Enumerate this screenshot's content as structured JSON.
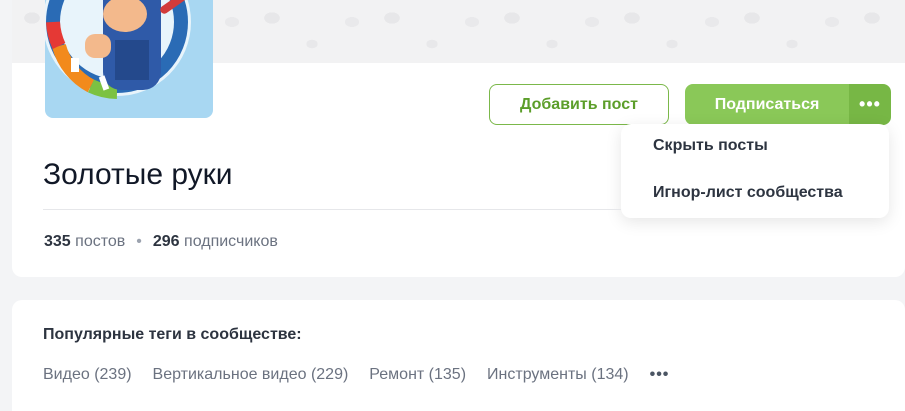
{
  "community": {
    "title": "Золотые руки",
    "posts_count": "335",
    "posts_label": "постов",
    "separator": "•",
    "subscribers_count": "296",
    "subscribers_label": "подписчиков"
  },
  "actions": {
    "add_post_label": "Добавить пост",
    "subscribe_label": "Подписаться",
    "more_label": "•••"
  },
  "menu": {
    "items": [
      {
        "label": "Скрыть посты"
      },
      {
        "label": "Игнор-лист сообщества"
      }
    ]
  },
  "tags": {
    "title": "Популярные теги в сообществе:",
    "items": [
      {
        "label": "Видео (239)"
      },
      {
        "label": "Вертикальное видео (229)"
      },
      {
        "label": "Ремонт (135)"
      },
      {
        "label": "Инструменты (134)"
      }
    ],
    "more_label": "•••"
  },
  "colors": {
    "accent_green": "#8ac858",
    "accent_green_dark": "#77b745",
    "outline_green": "#7bb84a"
  },
  "icons": {
    "avatar": "handyman-logo-icon"
  }
}
